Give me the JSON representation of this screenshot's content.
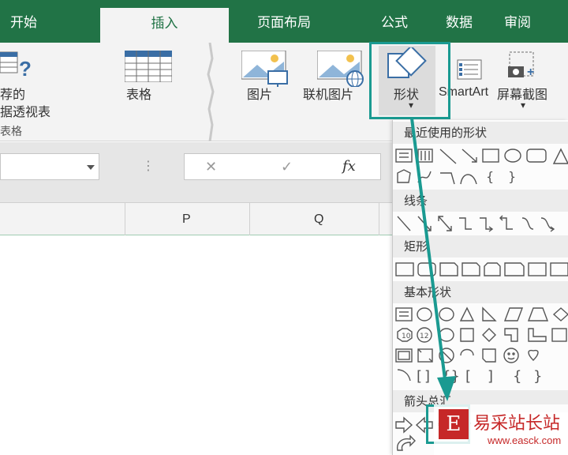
{
  "tabs": {
    "home": "开始",
    "insert": "插入",
    "page_layout": "页面布局",
    "formulas": "公式",
    "data": "数据",
    "review": "审阅"
  },
  "ribbon": {
    "pivot_line1": "荐的",
    "pivot_line2": "据透视表",
    "table": "表格",
    "pictures": "图片",
    "online_pictures": "联机图片",
    "shapes": "形状",
    "smartart": "SmartArt",
    "screenshot": "屏幕截图",
    "group_tables": "表格",
    "dropdown_arrow": "▾"
  },
  "formula_bar": {
    "cancel": "✕",
    "enter": "✓",
    "fx": "fx",
    "dots": "⋮"
  },
  "columns": [
    "P",
    "Q"
  ],
  "shapes_menu": {
    "recent": "最近使用的形状",
    "lines": "线条",
    "rectangles": "矩形",
    "basic": "基本形状",
    "block_arrows": "箭头总汇"
  },
  "watermark": {
    "text": "易采站长站",
    "url": "www.easck.com"
  },
  "colors": {
    "ribbon_green": "#217346",
    "highlight": "#1a9a91",
    "icon_blue": "#3a6ea5"
  }
}
